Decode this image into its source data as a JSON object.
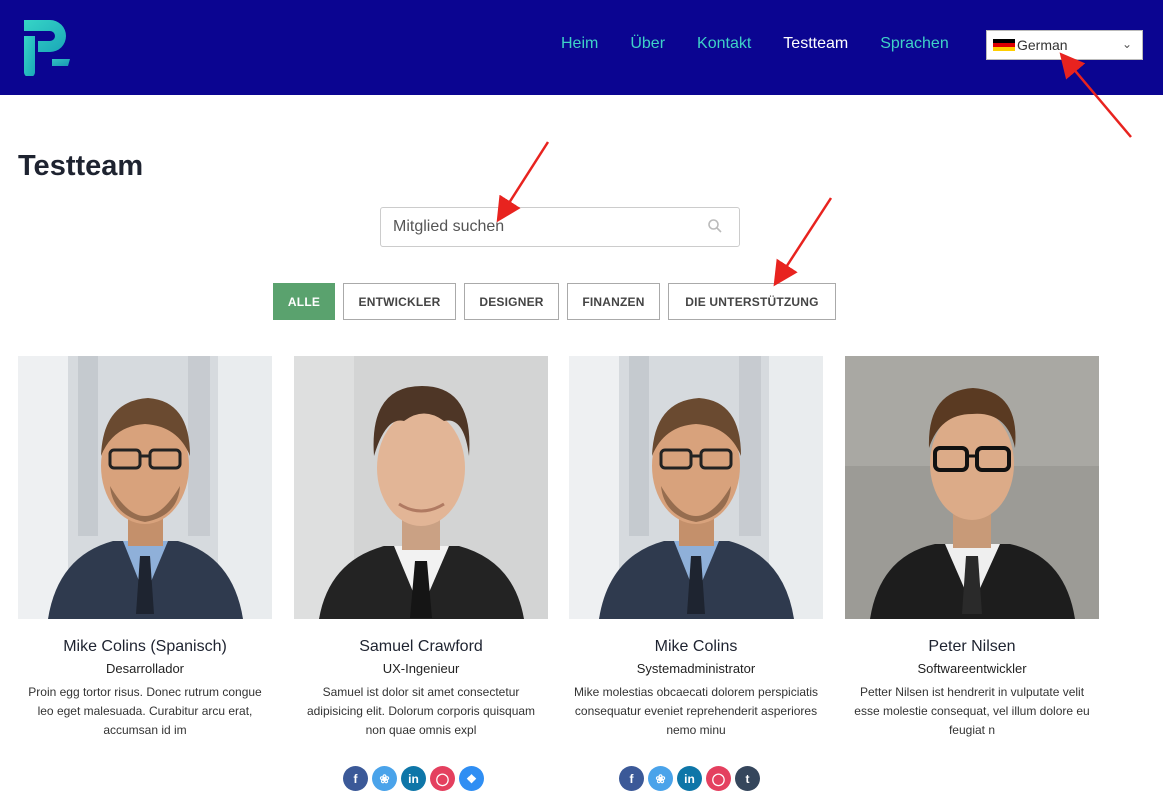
{
  "header": {
    "nav": [
      {
        "label": "Heim",
        "active": false
      },
      {
        "label": "Über",
        "active": false
      },
      {
        "label": "Kontakt",
        "active": false
      },
      {
        "label": "Testteam",
        "active": true
      },
      {
        "label": "Sprachen",
        "active": false
      }
    ],
    "language_select": {
      "value": "German"
    }
  },
  "page_title": "Testteam",
  "search": {
    "placeholder": "Mitglied suchen"
  },
  "filters": [
    "ALLE",
    "ENTWICKLER",
    "DESIGNER",
    "FINANZEN",
    "DIE UNTERSTÜTZUNG"
  ],
  "members": [
    {
      "name": "Mike Colins (Spanisch)",
      "role": "Desarrollador",
      "desc": "Proin egg tortor risus. Donec rutrum congue leo eget malesuada. Curabitur arcu erat, accumsan id im"
    },
    {
      "name": "Samuel Crawford",
      "role": "UX-Ingenieur",
      "desc": "Samuel ist dolor sit amet consectetur adipisicing elit. Dolorum corporis quisquam non quae omnis expl"
    },
    {
      "name": "Mike Colins",
      "role": "Systemadministrator",
      "desc": "Mike molestias obcaecati dolorem perspiciatis consequatur eveniet reprehenderit asperiores nemo minu"
    },
    {
      "name": "Peter Nilsen",
      "role": "Softwareentwickler",
      "desc": "Petter Nilsen ist hendrerit in vulputate velit esse molestie consequat, vel illum dolore eu feugiat n"
    }
  ],
  "colors": {
    "header_bg": "#0b0591",
    "nav_link": "#3fd2c7",
    "active_filter": "#5aa26e",
    "annotation_arrow": "#e8231f"
  },
  "social_icons": [
    [
      "facebook-icon",
      "twitter-icon",
      "linkedin-icon",
      "instagram-icon",
      "dropbox-icon"
    ],
    [
      "facebook-icon",
      "twitter-icon",
      "linkedin-icon",
      "instagram-icon",
      "tumblr-icon"
    ]
  ]
}
